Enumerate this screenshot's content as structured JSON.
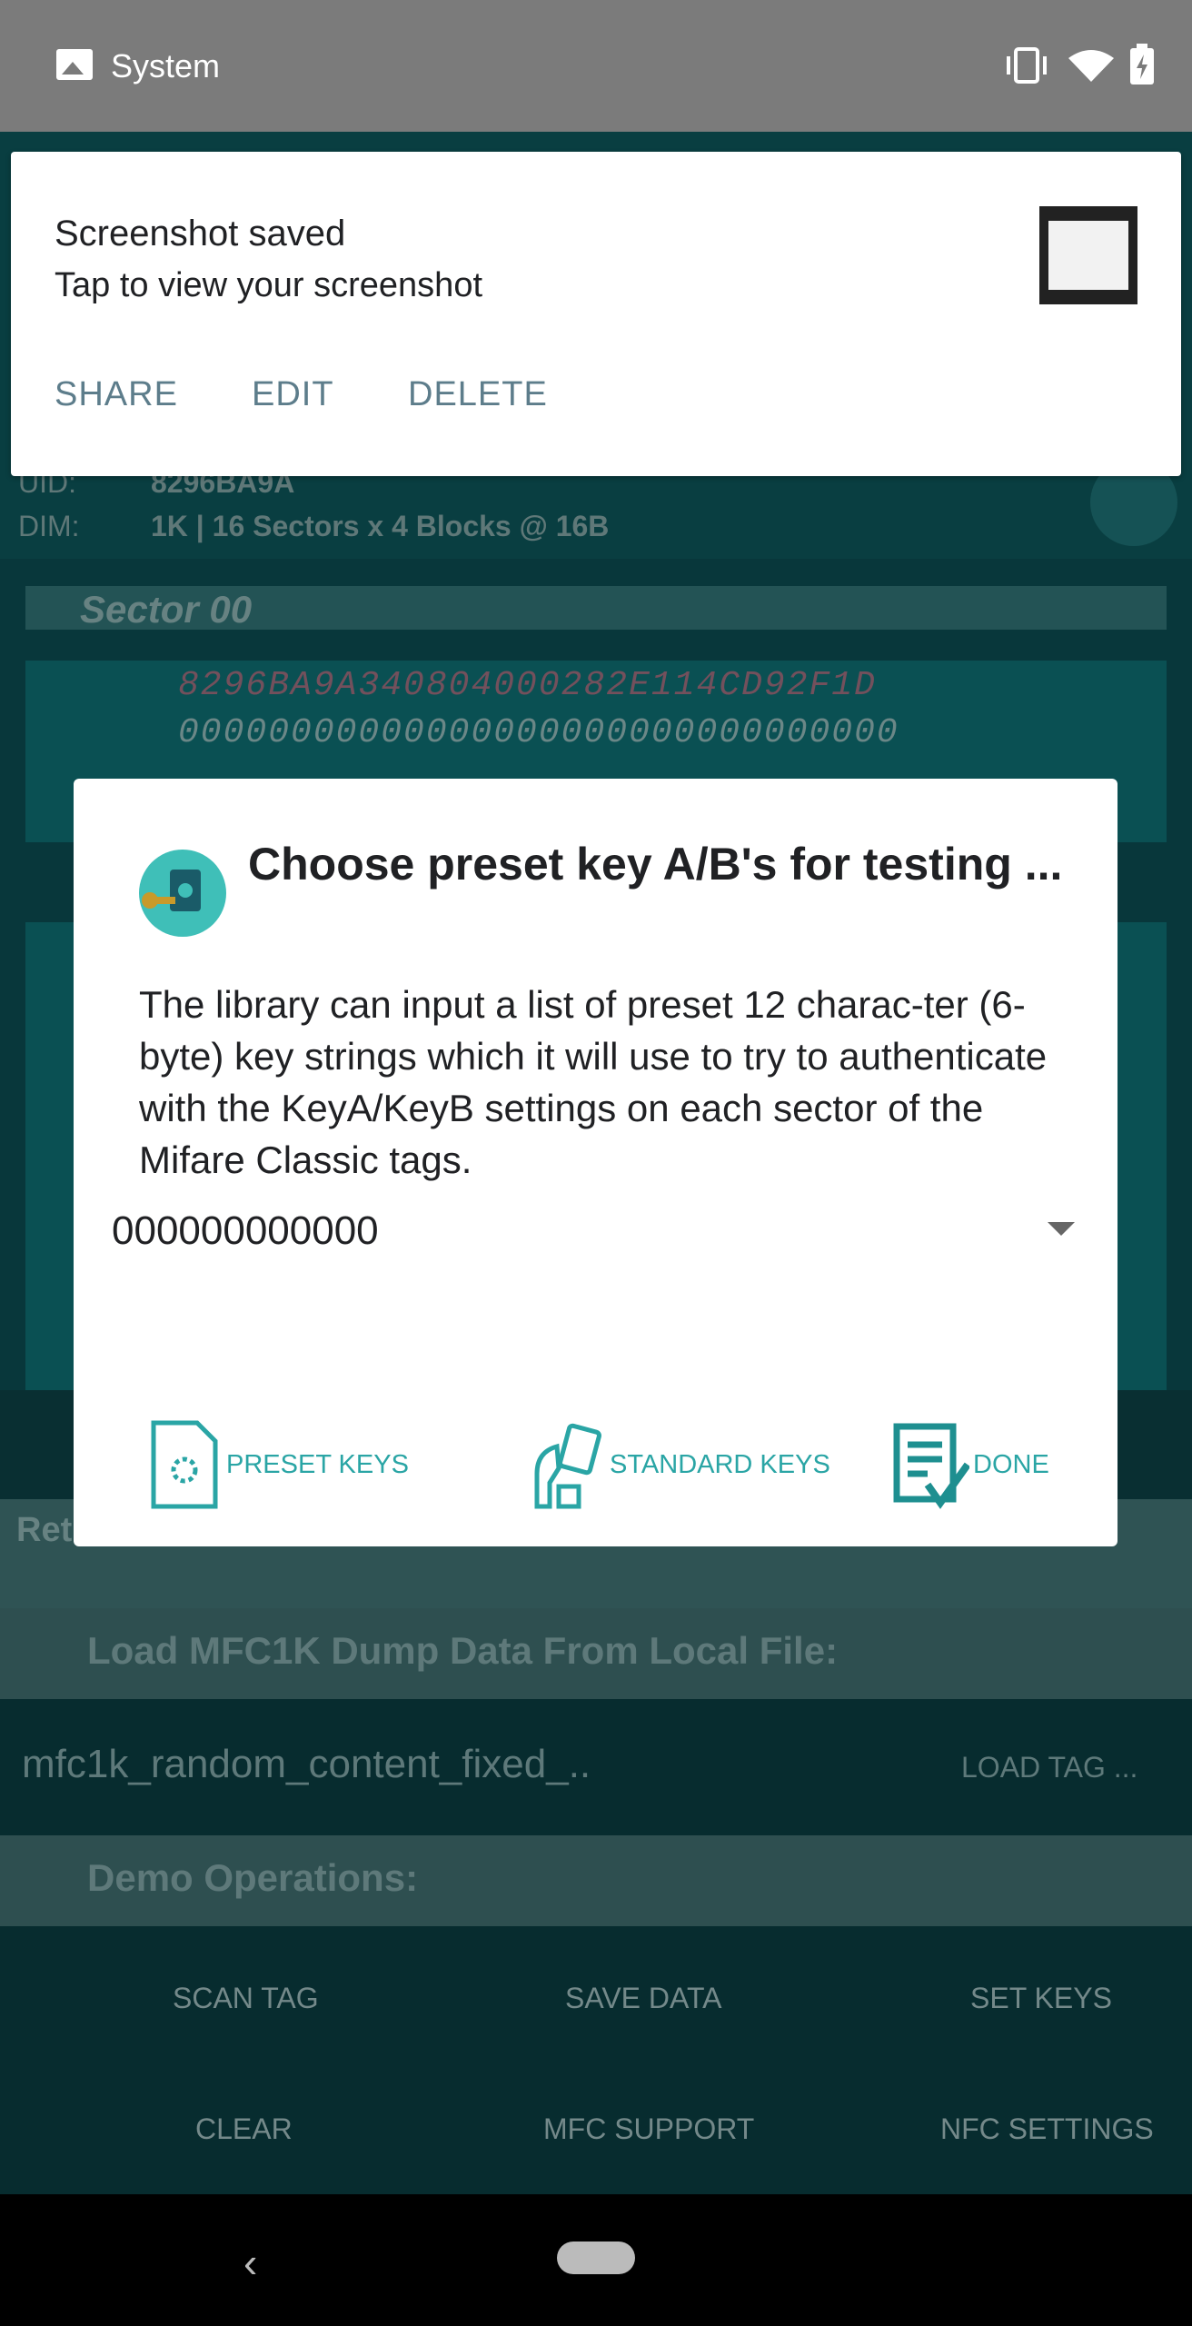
{
  "status_bar": {
    "app_label": "System"
  },
  "notification": {
    "title": "Screenshot saved",
    "text": "Tap to view your screenshot",
    "actions": [
      "SHARE",
      "EDIT",
      "DELETE"
    ]
  },
  "background": {
    "uid_label": "UID:",
    "uid_value": "8296BA9A",
    "dim_label": "DIM:",
    "dim_value": "1K | 16 Sectors x 4 Blocks @ 16B",
    "sector_title": "Sector 00",
    "sector_rows": [
      "8296BA9A340804000282E114CD92F1D",
      "00000000000000000000000000000000"
    ],
    "ret_text": "Ret",
    "load_header": "Load MFC1K Dump Data From Local File:",
    "file_select": "mfc1k_random_content_fixed_..",
    "load_button": "LOAD TAG ...",
    "demo_header": "Demo Operations:",
    "demo_ops": [
      [
        "SCAN TAG",
        "SAVE DATA",
        "SET KEYS"
      ],
      [
        "CLEAR",
        "MFC SUPPORT",
        "NFC SETTINGS"
      ]
    ]
  },
  "dialog": {
    "title": "Choose preset key A/B's for testing ...",
    "body": "The library can input a list of preset 12 charac-ter (6-byte) key strings which it will use to try to authenticate with the KeyA/KeyB settings on each sector of the Mifare Classic tags.",
    "selected_key": "000000000000",
    "buttons": {
      "preset": "PRESET KEYS",
      "standard": "STANDARD KEYS",
      "done": "DONE"
    },
    "accent_color": "#2aa5a5"
  },
  "icons": [
    "image-icon",
    "vibrate-icon",
    "wifi-icon",
    "battery-icon",
    "lock-key-icon",
    "preset-keys-icon",
    "standard-keys-icon",
    "done-icon",
    "back-icon",
    "home-icon"
  ]
}
